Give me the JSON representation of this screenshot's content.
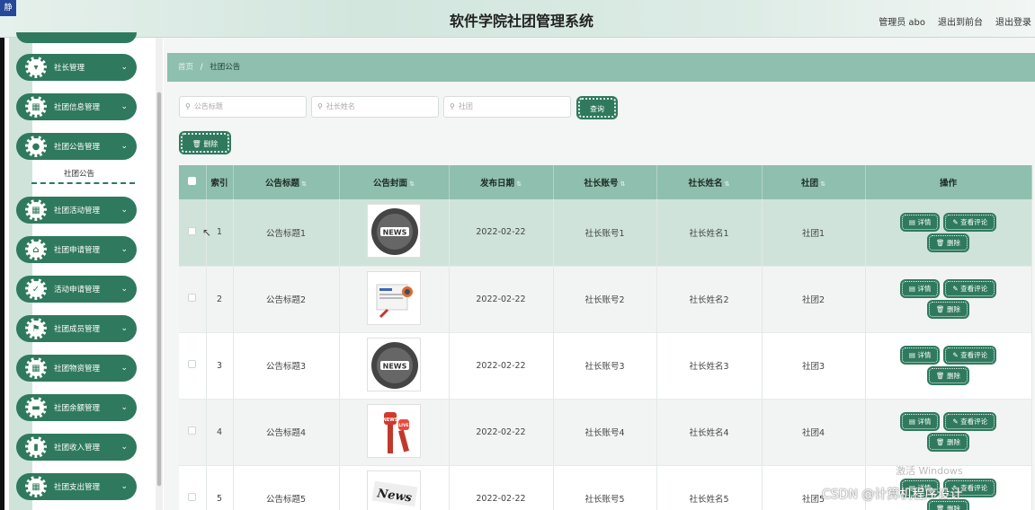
{
  "app": {
    "title": "软件学院社团管理系统",
    "corner_badge": "静",
    "admin_label": "管理员 abo",
    "to_front_label": "退出到前台",
    "logout_label": "退出登录"
  },
  "sidebar": {
    "items": [
      {
        "label": "社长管理",
        "icon": "shield-icon"
      },
      {
        "label": "社团信息管理",
        "icon": "grid-icon"
      },
      {
        "label": "社团公告管理",
        "icon": "pin-icon"
      },
      {
        "label": "社团活动管理",
        "icon": "grid-icon"
      },
      {
        "label": "社团申请管理",
        "icon": "home-icon"
      },
      {
        "label": "活动申请管理",
        "icon": "check-icon"
      },
      {
        "label": "社团成员管理",
        "icon": "flag-icon"
      },
      {
        "label": "社团物资管理",
        "icon": "grid-icon"
      },
      {
        "label": "社团余额管理",
        "icon": "card-icon"
      },
      {
        "label": "社团收入管理",
        "icon": "bar-chart-icon"
      },
      {
        "label": "社团支出管理",
        "icon": "grid-icon"
      }
    ],
    "sub_item": "社团公告"
  },
  "breadcrumb": {
    "home": "首页",
    "separator": "/",
    "current": "社团公告"
  },
  "search": {
    "title_placeholder": "公告标题",
    "name_placeholder": "社长姓名",
    "club_placeholder": "社团",
    "query_label": "查询",
    "delete_label": "删除"
  },
  "table": {
    "headers": [
      "索引",
      "公告标题",
      "公告封面",
      "发布日期",
      "社长账号",
      "社长姓名",
      "社团",
      "操作"
    ],
    "rows": [
      {
        "index": "1",
        "title": "公告标题1",
        "cover": "news-circle-icon",
        "date": "2022-02-22",
        "account": "社长账号1",
        "name": "社长姓名1",
        "club": "社团1"
      },
      {
        "index": "2",
        "title": "公告标题2",
        "cover": "news-paper-icon",
        "date": "2022-02-22",
        "account": "社长账号2",
        "name": "社长姓名2",
        "club": "社团2"
      },
      {
        "index": "3",
        "title": "公告标题3",
        "cover": "news-circle-icon",
        "date": "2022-02-22",
        "account": "社长账号3",
        "name": "社长姓名3",
        "club": "社团3"
      },
      {
        "index": "4",
        "title": "公告标题4",
        "cover": "microphone-icon",
        "date": "2022-02-22",
        "account": "社长账号4",
        "name": "社长姓名4",
        "club": "社团4"
      },
      {
        "index": "5",
        "title": "公告标题5",
        "cover": "news-stamp-icon",
        "date": "2022-02-22",
        "account": "社长账号5",
        "name": "社长姓名5",
        "club": "社团5"
      }
    ],
    "actions": {
      "detail": "详情",
      "comments": "查看评论",
      "delete": "删除"
    }
  },
  "watermarks": {
    "windows": "激活 Windows",
    "csdn": "CSDN @计算机程序设计"
  },
  "colors": {
    "accent": "#2f7a5e",
    "header_green": "#8fbfae",
    "hover_row": "#cfe3da"
  }
}
